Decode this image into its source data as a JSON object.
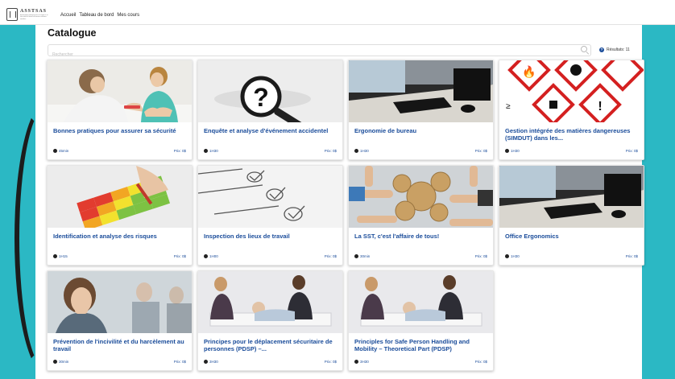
{
  "header": {
    "logo_name": "ASSTSAS",
    "logo_subtitle": "Association paritaire pour la santé et la sécurité du travail du secteur affaires sociales",
    "nav": [
      "Accueil",
      "Tableau de bord",
      "Mes cours"
    ]
  },
  "catalogue": {
    "title": "Catalogue",
    "search_placeholder": "Rechercher",
    "results_label": "Résultats: 11"
  },
  "courses": [
    {
      "title": "Bonnes pratiques pour assurer sa sécurité",
      "duration": "45min",
      "price": "Prix: 0$",
      "image": "nurse-patient-conversation"
    },
    {
      "title": "Enquête et analyse d'événement accidentel",
      "duration": "1H30",
      "price": "Prix: 0$",
      "image": "magnifying-glass-question"
    },
    {
      "title": "Ergonomie de bureau",
      "duration": "1H30",
      "price": "Prix: 0$",
      "image": "office-desk-keyboard"
    },
    {
      "title": "Gestion intégrée des matières dangereuses (SIMDUT) dans les...",
      "duration": "1H30",
      "price": "Prix: 0$",
      "image": "hazard-pictograms"
    },
    {
      "title": "Identification et analyse des risques",
      "duration": "1H15",
      "price": "Prix: 0$",
      "image": "risk-matrix"
    },
    {
      "title": "Inspection des lieux de travail",
      "duration": "1H00",
      "price": "Prix: 0$",
      "image": "checklist"
    },
    {
      "title": "La SST, c'est l'affaire de tous!",
      "duration": "30min",
      "price": "Prix: 0$",
      "image": "team-gears"
    },
    {
      "title": "Office Ergonomics",
      "duration": "1H30",
      "price": "Prix: 0$",
      "image": "office-desk-keyboard"
    },
    {
      "title": "Prévention de l'incivilité et du harcèlement au travail",
      "duration": "30min",
      "price": "Prix: 0$",
      "image": "worried-woman"
    },
    {
      "title": "Principes pour le déplacement sécuritaire de personnes (PDSP) –...",
      "duration": "3H30",
      "price": "Prix: 0$",
      "image": "patient-handling"
    },
    {
      "title": "Principles for Safe Person Handling and Mobility – Theoretical Part (PDSP)",
      "duration": "3H30",
      "price": "Prix: 0$",
      "image": "patient-handling"
    }
  ],
  "colors": {
    "accent": "#1a4c9a",
    "background": "#2bb8c4"
  }
}
